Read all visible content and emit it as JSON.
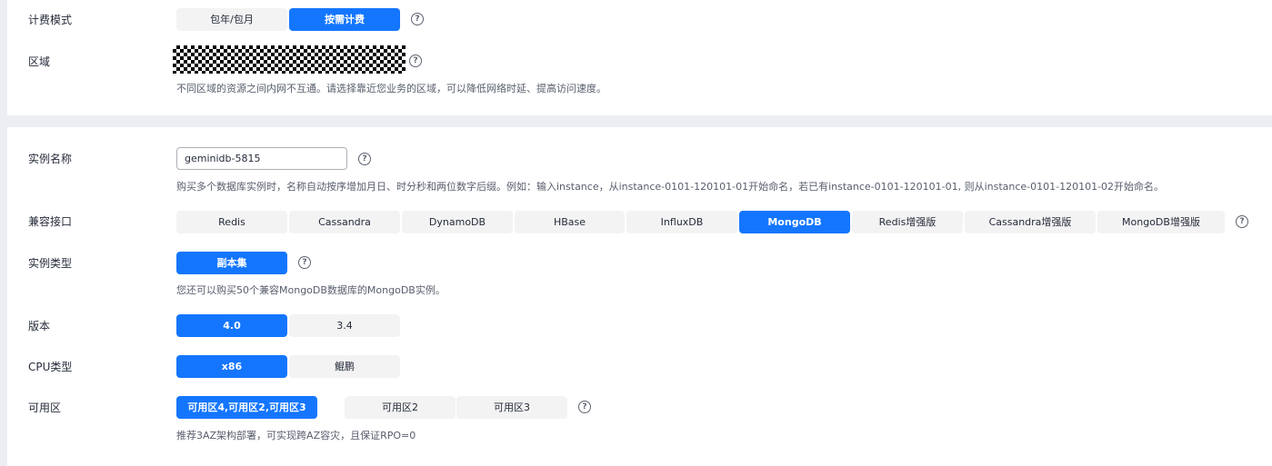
{
  "billing": {
    "label": "计费模式",
    "options": [
      "包年/包月",
      "按需计费"
    ],
    "selected": "按需计费"
  },
  "region": {
    "label": "区域",
    "hint": "不同区域的资源之间内网不互通。请选择靠近您业务的区域，可以降低网络时延、提高访问速度。"
  },
  "instance_name": {
    "label": "实例名称",
    "value": "geminidb-5815",
    "hint": "购买多个数据库实例时，名称自动按序增加月日、时分秒和两位数字后缀。例如：输入instance，从instance-0101-120101-01开始命名，若已有instance-0101-120101-01, 则从instance-0101-120101-02开始命名。"
  },
  "compat": {
    "label": "兼容接口",
    "options": [
      "Redis",
      "Cassandra",
      "DynamoDB",
      "HBase",
      "InfluxDB",
      "MongoDB",
      "Redis增强版",
      "Cassandra增强版",
      "MongoDB增强版"
    ],
    "selected": "MongoDB"
  },
  "instance_type": {
    "label": "实例类型",
    "options": [
      "副本集"
    ],
    "selected": "副本集",
    "hint": "您还可以购买50个兼容MongoDB数据库的MongoDB实例。"
  },
  "version": {
    "label": "版本",
    "options": [
      "4.0",
      "3.4"
    ],
    "selected": "4.0"
  },
  "cpu": {
    "label": "CPU类型",
    "options": [
      "x86",
      "鲲鹏"
    ],
    "selected": "x86"
  },
  "az": {
    "label": "可用区",
    "options": [
      "可用区4,可用区2,可用区3",
      "可用区2",
      "可用区3"
    ],
    "selected": "可用区4,可用区2,可用区3",
    "hint": "推荐3AZ架构部署，可实现跨AZ容灾，且保证RPO=0"
  },
  "help_glyph": "?",
  "colors": {
    "accent": "#1476ff",
    "segment_bg": "#f3f3f3",
    "page_bg": "#eceef3"
  }
}
